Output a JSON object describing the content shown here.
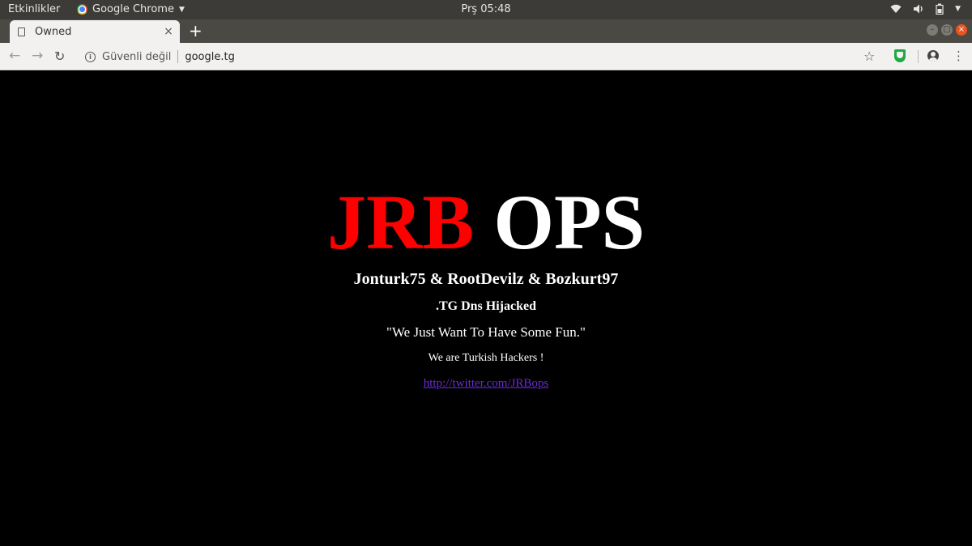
{
  "topbar": {
    "activities": "Etkinlikler",
    "app_name": "Google Chrome",
    "clock": "Prş 05:48",
    "icons": [
      "wifi-icon",
      "volume-icon",
      "battery-icon",
      "chevron-down-icon"
    ]
  },
  "tab": {
    "title": "Owned",
    "close": "×",
    "new_tab": "+"
  },
  "toolbar": {
    "back": "←",
    "forward": "→",
    "reload": "↻",
    "security_label": "Güvenli değil",
    "url": "google.tg",
    "star": "☆",
    "menu": "⋮"
  },
  "page": {
    "headline_red": "JRB",
    "headline_white": "OPS",
    "authors": "Jonturk75 & RootDevilz & Bozkurt97",
    "hijacked": ".TG Dns Hijacked",
    "quote": "\"We Just Want To Have Some Fun.\"",
    "turkish": "We are Turkish Hackers !",
    "link": "http://twitter.com/JRBops"
  },
  "colors": {
    "headline_red": "#ff0000",
    "link": "#6a2bd9",
    "topbar_bg": "#3c3b37",
    "close_button": "#e95420"
  }
}
